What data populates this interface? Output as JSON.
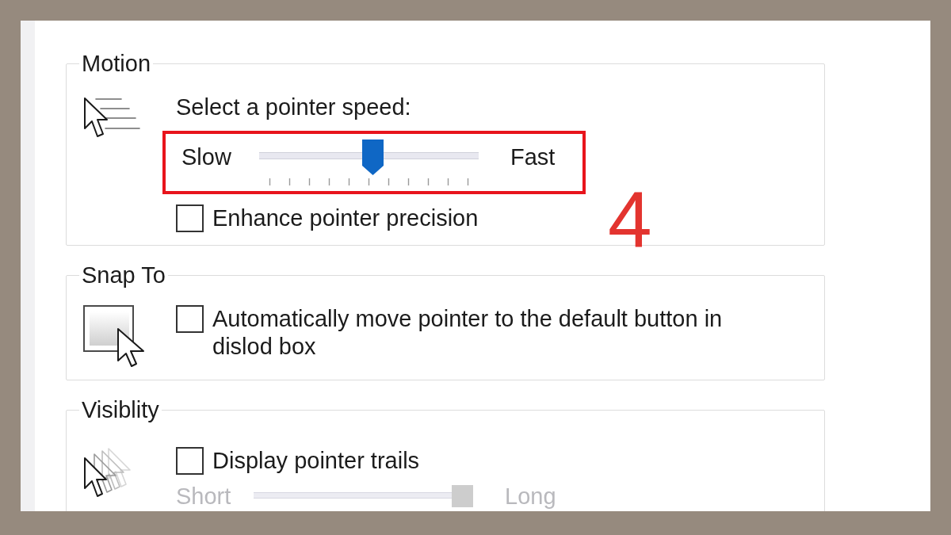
{
  "groups": [
    {
      "kind": "motion",
      "title": "Motion",
      "rows": [
        {
          "kind": "text",
          "text": "Select a pointer speed:"
        },
        {
          "kind": "slider",
          "min_label": "Slow",
          "max_label": "Fast",
          "level": 0.52,
          "disabled": false,
          "highlighted": true
        },
        {
          "kind": "checkbox",
          "label": "Enhance pointer precision",
          "checked": false
        }
      ]
    },
    {
      "kind": "snap",
      "title": "Snap To",
      "rows": [
        {
          "kind": "checkbox",
          "label": "Automatically move pointer to the default button in dislod box",
          "checked": false
        }
      ]
    },
    {
      "kind": "visibility",
      "title": "Visiblity",
      "rows": [
        {
          "kind": "checkbox",
          "label": "Display pointer trails",
          "checked": false
        },
        {
          "kind": "slider",
          "min_label": "Short",
          "max_label": "Long",
          "level": 1,
          "disabled": true,
          "highlighted": false
        }
      ]
    }
  ],
  "annotation": {
    "label": "4"
  }
}
